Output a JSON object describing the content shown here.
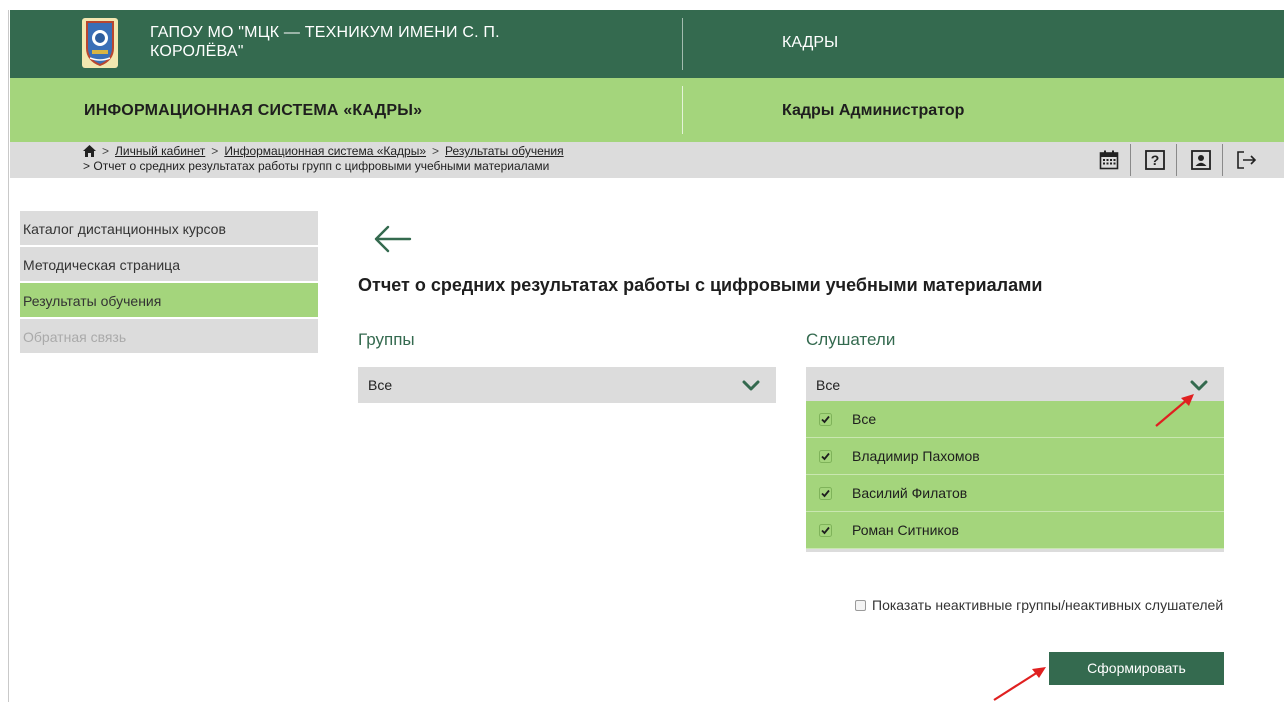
{
  "header": {
    "org_name": "ГАПОУ МО \"МЦК — ТЕХНИКУМ ИМЕНИ С. П. КОРОЛЁВА\"",
    "section": "КАДРЫ",
    "system_title": "ИНФОРМАЦИОННАЯ СИСТЕМА «КАДРЫ»",
    "user_role": "Кадры Администратор",
    "logo_icon": "emblem-shield-icon"
  },
  "breadcrumb": {
    "home_icon": "home-icon",
    "separator": ">",
    "items": [
      "Личный кабинет",
      "Информационная система «Кадры»",
      "Результаты обучения"
    ],
    "current": "Отчет о средних результатах работы групп с цифровыми учебными материалами"
  },
  "toolbar": {
    "icons": [
      "calendar-icon",
      "help-icon",
      "profile-icon",
      "logout-icon"
    ],
    "help_glyph": "?"
  },
  "sidebar": {
    "items": [
      {
        "label": "Каталог дистанционных курсов",
        "state": "normal"
      },
      {
        "label": "Методическая страница",
        "state": "normal"
      },
      {
        "label": "Результаты обучения",
        "state": "active"
      },
      {
        "label": "Обратная связь",
        "state": "disabled"
      }
    ]
  },
  "main": {
    "back_icon": "arrow-left-icon",
    "title": "Отчет о средних результатах работы с цифровыми учебными материалами",
    "groups_label": "Группы",
    "groups_value": "Все",
    "listeners_label": "Слушатели",
    "listeners_value": "Все",
    "listeners_options": [
      {
        "label": "Все",
        "checked": true
      },
      {
        "label": "Владимир Пахомов",
        "checked": true
      },
      {
        "label": "Василий Филатов",
        "checked": true
      },
      {
        "label": "Роман Ситников",
        "checked": true
      }
    ],
    "show_inactive_label": "Показать неактивные группы/неактивных слушателей",
    "show_inactive_checked": false,
    "submit_label": "Сформировать"
  },
  "colors": {
    "dark_green": "#346a4f",
    "light_green": "#a4d57c",
    "gray": "#dcdcdc",
    "annotation_red": "#e02020"
  }
}
